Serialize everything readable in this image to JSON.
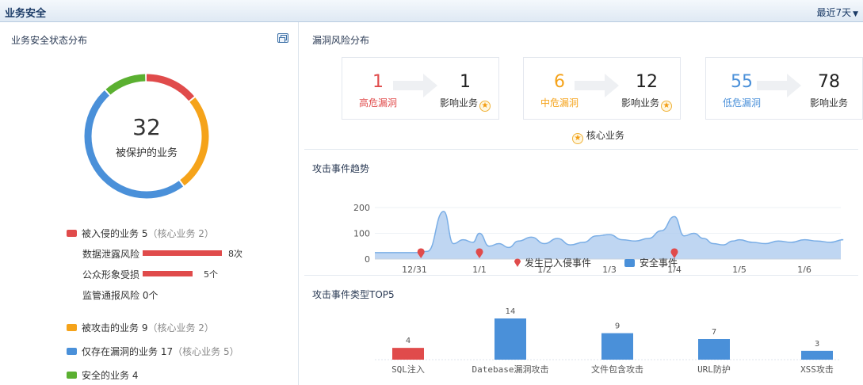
{
  "header": {
    "title": "业务安全",
    "range_label": "最近7天"
  },
  "left": {
    "title": "业务安全状态分布",
    "total": "32",
    "total_label": "被保护的业务",
    "donut_segments": [
      {
        "name": "invaded",
        "value": 5,
        "color": "#e04b4b"
      },
      {
        "name": "attacked",
        "value": 9,
        "color": "#f5a31a"
      },
      {
        "name": "vuln_only",
        "value": 17,
        "color": "#4a90d9"
      },
      {
        "name": "safe",
        "value": 4,
        "color": "#5bb031"
      }
    ],
    "legend": [
      {
        "label": "被入侵的业务",
        "count": "5",
        "note": "（核心业务 2）",
        "color": "#e04b4b"
      },
      {
        "label": "被攻击的业务",
        "count": "9",
        "note": "（核心业务 2）",
        "color": "#f5a31a"
      },
      {
        "label": "仅存在漏洞的业务",
        "count": "17",
        "note": "（核心业务 5）",
        "color": "#4a90d9"
      },
      {
        "label": "安全的业务",
        "count": "4",
        "note": "",
        "color": "#5bb031"
      }
    ],
    "risks": [
      {
        "label": "数据泄露风险",
        "value": "8次",
        "ratio": 1.0
      },
      {
        "label": "公众形象受损",
        "value": "5个",
        "ratio": 0.625
      },
      {
        "label": "监管通报风险",
        "value": "0个",
        "ratio": 0
      }
    ]
  },
  "vuln": {
    "title": "漏洞风险分布",
    "cards": [
      {
        "count": "1",
        "level": "高危漏洞",
        "color": "#e04b4b",
        "affected": "1",
        "affected_label": "影响业务",
        "star": true
      },
      {
        "count": "6",
        "level": "中危漏洞",
        "color": "#f5a31a",
        "affected": "12",
        "affected_label": "影响业务",
        "star": true
      },
      {
        "count": "55",
        "level": "低危漏洞",
        "color": "#4a90d9",
        "affected": "78",
        "affected_label": "影响业务",
        "star": false
      }
    ],
    "core_legend": "核心业务"
  },
  "trend": {
    "title": "攻击事件趋势",
    "legend_invaded": "发生已入侵事件",
    "legend_safe": "安全事件"
  },
  "top5": {
    "title": "攻击事件类型TOP5"
  },
  "chart_data": [
    {
      "type": "area",
      "title": "攻击事件趋势",
      "x_ticks": [
        "12/31",
        "1/1",
        "1/2",
        "1/3",
        "1/4",
        "1/5",
        "1/6"
      ],
      "y_ticks": [
        "0",
        "100",
        "200"
      ],
      "ylim": [
        0,
        220
      ],
      "x": [
        0,
        0.2,
        0.45,
        0.6,
        0.75,
        0.9,
        1,
        1.15,
        1.3,
        1.45,
        1.6,
        1.8,
        2,
        2.2,
        2.4,
        2.6,
        2.8,
        3,
        3.2,
        3.4,
        3.6,
        3.8,
        4,
        4.15,
        4.3,
        4.45,
        4.6,
        4.75,
        4.9,
        5,
        5.2,
        5.4,
        5.6,
        5.8,
        6,
        6.2,
        6.4,
        6.6
      ],
      "values": [
        25,
        30,
        185,
        60,
        75,
        65,
        100,
        50,
        60,
        45,
        70,
        85,
        60,
        80,
        55,
        65,
        90,
        95,
        75,
        70,
        80,
        110,
        165,
        90,
        100,
        80,
        60,
        55,
        70,
        75,
        65,
        60,
        70,
        65,
        75,
        70,
        65,
        75
      ],
      "series": [
        {
          "name": "安全事件",
          "color": "#a9c8ee"
        }
      ],
      "invaded_events_at": [
        0.1,
        1.0,
        4.0
      ],
      "invaded_label": "发生已入侵事件"
    },
    {
      "type": "bar",
      "title": "攻击事件类型TOP5",
      "categories": [
        "SQL注入",
        "Datebase漏洞攻击",
        "文件包含攻击",
        "URL防护",
        "XSS攻击"
      ],
      "values": [
        4,
        14,
        9,
        7,
        3
      ],
      "colors": [
        "#e04b4b",
        "#4a90d9",
        "#4a90d9",
        "#4a90d9",
        "#4a90d9"
      ],
      "ylim": [
        0,
        14
      ]
    }
  ]
}
